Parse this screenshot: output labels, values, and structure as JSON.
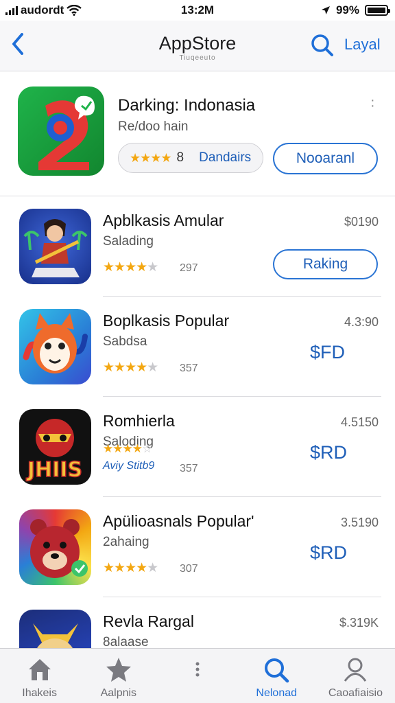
{
  "status_bar": {
    "carrier": "audordt",
    "time": "13:2M",
    "battery": "99%",
    "battery_level": 0.99
  },
  "nav": {
    "back_icon": "chevron-left-icon",
    "title": "AppStore",
    "subtitle": "Tiuqeeuto",
    "search_icon": "search-icon",
    "action_label": "Layal"
  },
  "featured": {
    "title": "Darking: Indonasia",
    "subtitle": "Re/doo hain",
    "rating_stars": "★★★★",
    "rating_num": "8",
    "rating_label": "Dandairs",
    "button_label": "Nooaranl",
    "more_icon": "more-vertical-icon"
  },
  "apps": [
    {
      "name": "Apblkasis Amular",
      "category": "Salading",
      "price": "$0190",
      "stars": 4.5,
      "count": "297",
      "button_label": "Raking"
    },
    {
      "name": "Boplkasis Popular",
      "category": "Sabdsa",
      "price": "4.3:90",
      "stars": 4.5,
      "count": "357",
      "action_price": "$FD"
    },
    {
      "name": "Romhierla",
      "category": "Saloding",
      "price": "4.5150",
      "stars": 4,
      "count": "357",
      "action_price": "$RD",
      "extra": "Aviy Stitb9"
    },
    {
      "name": "Apülioasnals Popular'",
      "category": "2ahaing",
      "price": "3.5190",
      "stars": 4.5,
      "count": "307",
      "action_price": "$RD"
    },
    {
      "name": "Revla Rargal",
      "category": "8alaase",
      "price": "$.319K"
    }
  ],
  "tabs": [
    {
      "label": "Ihakeis",
      "icon": "home-icon",
      "active": false
    },
    {
      "label": "Aalpnis",
      "icon": "star-icon",
      "active": false
    },
    {
      "label": "",
      "icon": "more-dots-icon",
      "active": false
    },
    {
      "label": "Nelonad",
      "icon": "search-icon",
      "active": true
    },
    {
      "label": "Caoafiaisio",
      "icon": "person-icon",
      "active": false
    }
  ],
  "colors": {
    "accent": "#1f6fd8",
    "star": "#f3a712",
    "featured_icon": "#1fb34a"
  }
}
